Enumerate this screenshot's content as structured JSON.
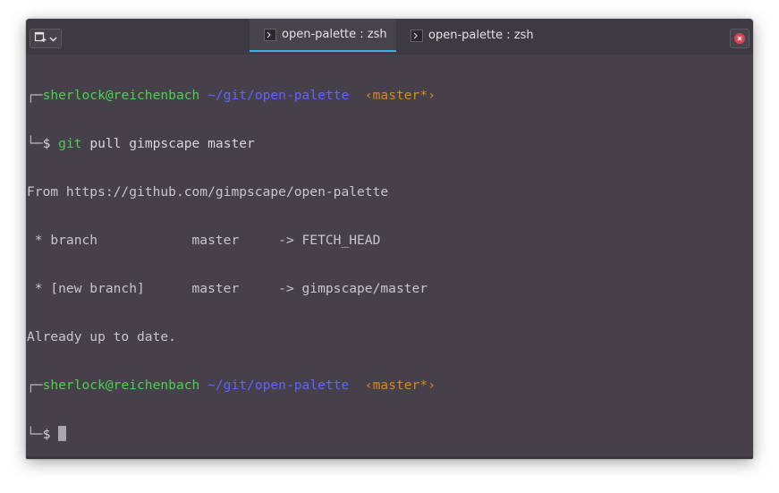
{
  "window": {
    "tabs": [
      {
        "label": "open-palette : zsh",
        "icon": "terminal-icon",
        "active": true
      },
      {
        "label": "open-palette : zsh",
        "icon": "terminal-icon",
        "active": false
      }
    ],
    "new_tab_icon": "new-tab-icon",
    "close_icon": "close-icon"
  },
  "terminal": {
    "prompt1": {
      "corner_top": "┌─",
      "user_host": "sherlock@reichenbach",
      "path": "~/git/open-palette",
      "branch": "‹master*›",
      "corner_bottom": "└─",
      "symbol": "$",
      "cmd_git": "git",
      "cmd_rest": "pull gimpscape master"
    },
    "output": [
      "From https://github.com/gimpscape/open-palette",
      " * branch            master     -> FETCH_HEAD",
      " * [new branch]      master     -> gimpscape/master",
      "Already up to date."
    ],
    "prompt2": {
      "corner_top": "┌─",
      "user_host": "sherlock@reichenbach",
      "path": "~/git/open-palette",
      "branch": "‹master*›",
      "corner_bottom": "└─",
      "symbol": "$"
    }
  },
  "colors": {
    "background": "#45404a",
    "user_host": "#4fd04f",
    "path": "#6363ff",
    "branch": "#d58a1a",
    "tab_accent": "#3daee9",
    "close": "#da4453"
  }
}
